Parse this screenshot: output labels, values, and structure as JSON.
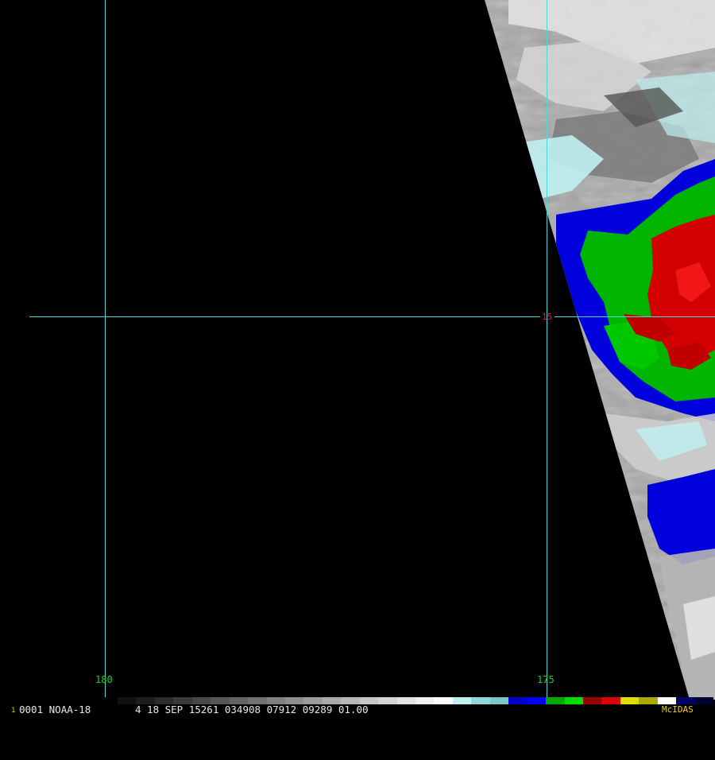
{
  "image": {
    "satellite": "NOAA-18",
    "frame": "1",
    "frame_code": "0001",
    "datetime_line": "4 18 SEP 15261 034908 07912 09289 01.00",
    "software_logo": "McIDAS"
  },
  "grid": {
    "longitude_labels": [
      "180",
      "175"
    ],
    "latitude_labels": [
      "15"
    ],
    "line_color": "#4fd6d6",
    "longitude_label_color": "#22cc22",
    "latitude_label_color": "#dd2222"
  },
  "colorbar": {
    "colors": [
      "#101010",
      "#1e1e1e",
      "#2c2c2c",
      "#3a3a3a",
      "#484848",
      "#565656",
      "#646464",
      "#727272",
      "#808080",
      "#8e8e8e",
      "#9c9c9c",
      "#aaaaaa",
      "#b8b8b8",
      "#c6c6c6",
      "#d4d4d4",
      "#e2e2e2",
      "#f0f0f0",
      "#ffffff",
      "#bff0f0",
      "#8fd8d8",
      "#7ac6c6",
      "#0000cc",
      "#0000ff",
      "#00aa00",
      "#00dd00",
      "#990000",
      "#dd0000",
      "#dddd00",
      "#aaaa00",
      "#ffffff",
      "#000066",
      "#000033"
    ]
  }
}
